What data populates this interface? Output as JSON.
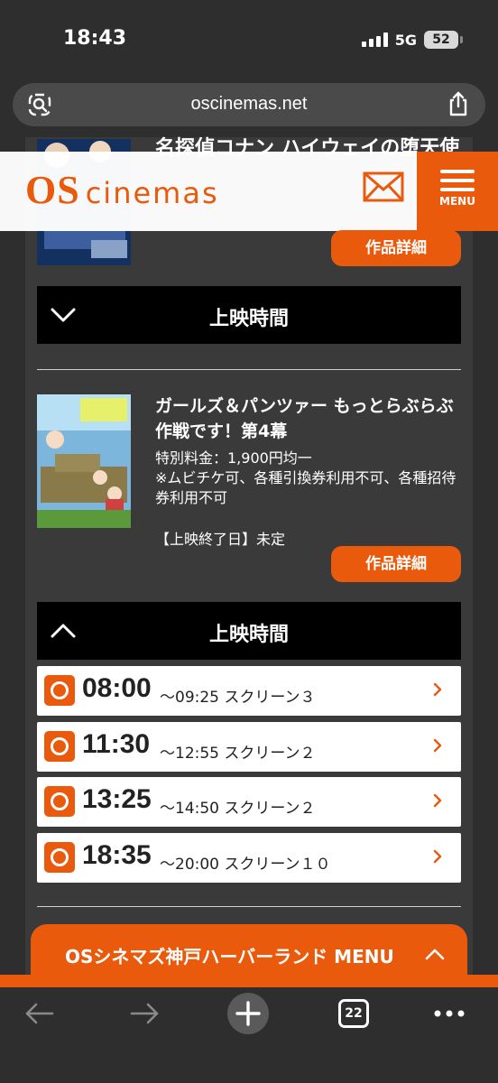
{
  "status_bar": {
    "time": "18:43",
    "network": "5G",
    "battery": "52"
  },
  "browser": {
    "url": "oscinemas.net",
    "tab_count": "22"
  },
  "site_header": {
    "logo_os": "OS",
    "logo_cinemas": "cinemas",
    "menu_label": "MENU"
  },
  "movie1": {
    "title": "名探偵コナン ハイウェイの堕天使",
    "detail_button": "作品詳細",
    "showtime_toggle": "上映時間"
  },
  "movie2": {
    "title": "ガールズ＆パンツァー もっとらぶらぶ作戦です！第4幕",
    "price": "特別料金：1,900円均一",
    "notes": "※ムビチケ可、各種引換券利用不可、各種招待券利用不可",
    "end_date": "【上映終了日】未定",
    "detail_button": "作品詳細",
    "showtime_toggle": "上映時間",
    "showtimes": [
      {
        "start": "08:00",
        "end": "〜09:25",
        "screen": "スクリーン３"
      },
      {
        "start": "11:30",
        "end": "〜12:55",
        "screen": "スクリーン２"
      },
      {
        "start": "13:25",
        "end": "〜14:50",
        "screen": "スクリーン２"
      },
      {
        "start": "18:35",
        "end": "〜20:00",
        "screen": "スクリーン１０"
      }
    ]
  },
  "theater_menu": {
    "label": "OSシネマズ神戸ハーバーランド MENU"
  },
  "colors": {
    "accent": "#ea5a0c",
    "background": "#3a3a3a"
  }
}
